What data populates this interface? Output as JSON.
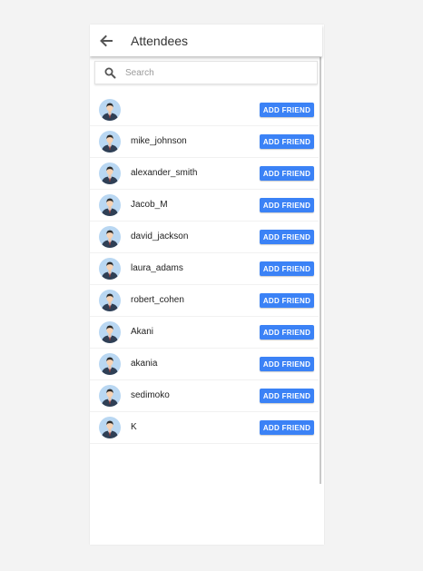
{
  "header": {
    "title": "Attendees",
    "back_icon": "arrow-left-icon"
  },
  "search": {
    "placeholder": "Search",
    "value": "",
    "icon": "search-icon"
  },
  "colors": {
    "accent": "#3b82f6",
    "background": "#f3f3f3"
  },
  "attendees": [
    {
      "name": "",
      "action": "ADD FRIEND"
    },
    {
      "name": "mike_johnson",
      "action": "ADD FRIEND"
    },
    {
      "name": "alexander_smith",
      "action": "ADD FRIEND"
    },
    {
      "name": "Jacob_M",
      "action": "ADD FRIEND"
    },
    {
      "name": "david_jackson",
      "action": "ADD FRIEND"
    },
    {
      "name": "laura_adams",
      "action": "ADD FRIEND"
    },
    {
      "name": "robert_cohen",
      "action": "ADD FRIEND"
    },
    {
      "name": "Akani",
      "action": "ADD FRIEND"
    },
    {
      "name": "akania",
      "action": "ADD FRIEND"
    },
    {
      "name": "sedimoko",
      "action": "ADD FRIEND"
    },
    {
      "name": "K",
      "action": "ADD FRIEND"
    }
  ]
}
